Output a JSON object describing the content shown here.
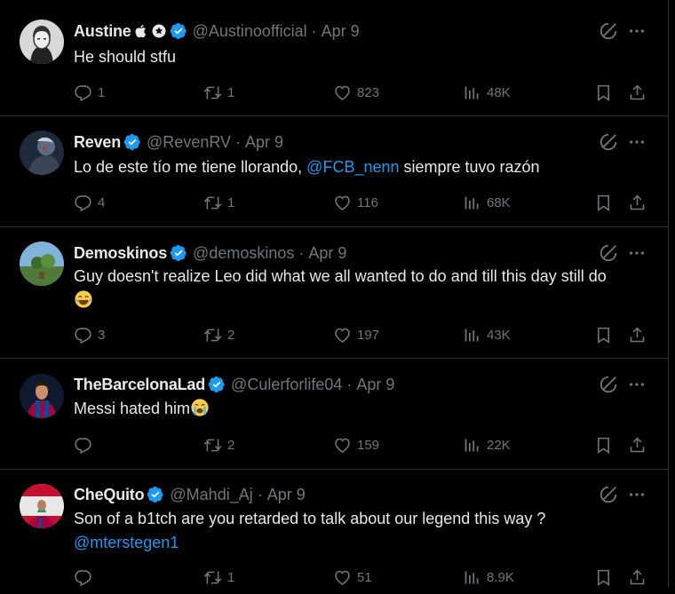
{
  "colors": {
    "background": "#000000",
    "text": "#e7e9ea",
    "muted": "#71767b",
    "accent": "#1d9bf0",
    "divider": "#2f3336"
  },
  "tweets": [
    {
      "name": "Austine",
      "extra_badges": [
        "apple-icon",
        "star-badge-icon"
      ],
      "handle": "@Austinoofficial",
      "date": "Apr 9",
      "text": "He should stfu",
      "replies": "1",
      "reposts": "1",
      "likes": "823",
      "views": "48K"
    },
    {
      "name": "Reven",
      "handle": "@RevenRV",
      "date": "Apr 9",
      "text_before": "Lo de este tío me tiene llorando, ",
      "mention": "@FCB_nenn",
      "text_after": " siempre tuvo razón",
      "replies": "4",
      "reposts": "1",
      "likes": "116",
      "views": "68K"
    },
    {
      "name": "Demoskinos",
      "handle": "@demoskinos",
      "date": "Apr 9",
      "text": "Guy doesn't realize Leo did what we all wanted to do and till this day still do",
      "emoji": "joy-emoji",
      "replies": "3",
      "reposts": "2",
      "likes": "197",
      "views": "43K"
    },
    {
      "name": "TheBarcelonaLad",
      "handle": "@Culerforlife04",
      "date": "Apr 9",
      "text": "Messi hated him",
      "emoji": "sob-emoji",
      "replies": "",
      "reposts": "2",
      "likes": "159",
      "views": "22K"
    },
    {
      "name": "CheQuito",
      "handle": "@Mahdi_Aj",
      "date": "Apr 9",
      "text": "Son of a b1tch are you retarded to talk about our legend this way ?",
      "mention": "@mterstegen1",
      "replies": "",
      "reposts": "1",
      "likes": "51",
      "views": "8.9K"
    }
  ]
}
